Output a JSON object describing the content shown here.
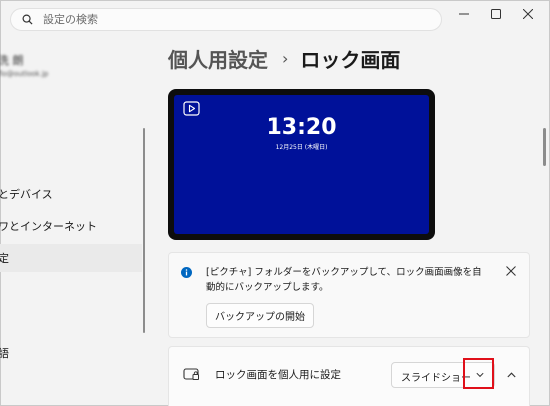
{
  "search": {
    "placeholder": "設定の検索"
  },
  "window_controls": {
    "minimize_icon": "minimize-icon",
    "maximize_icon": "maximize-icon",
    "close_icon": "close-icon"
  },
  "account": {
    "name": "洗 朗",
    "email": "flo@outlook.jp"
  },
  "sidebar": {
    "items": [
      {
        "label": "とデバイス",
        "active": false
      },
      {
        "label": "ワとインターネット",
        "active": false
      },
      {
        "label": "定",
        "active": true
      },
      {
        "label": "語",
        "active": false
      }
    ]
  },
  "header": {
    "parent": "個人用設定",
    "separator": "›",
    "current": "ロック画面"
  },
  "preview": {
    "time": "13:20",
    "date": "12月25日 (木曜日)",
    "slideshow_icon": "slideshow-icon"
  },
  "info": {
    "message": "[ピクチャ] フォルダーをバックアップして、ロック画面画像を自動的にバックアップします。",
    "button_label": "バックアップの開始",
    "icon": "info-icon",
    "close_icon": "close-icon"
  },
  "lock_screen_setting": {
    "label": "ロック画面を個人用に設定",
    "selected_value": "スライドショー",
    "icon": "lock-screen-icon",
    "expand_icon": "chevron-up-icon"
  },
  "colors": {
    "accent": "#0067c0",
    "preview_background": "#001199",
    "highlight": "#e0101a"
  }
}
